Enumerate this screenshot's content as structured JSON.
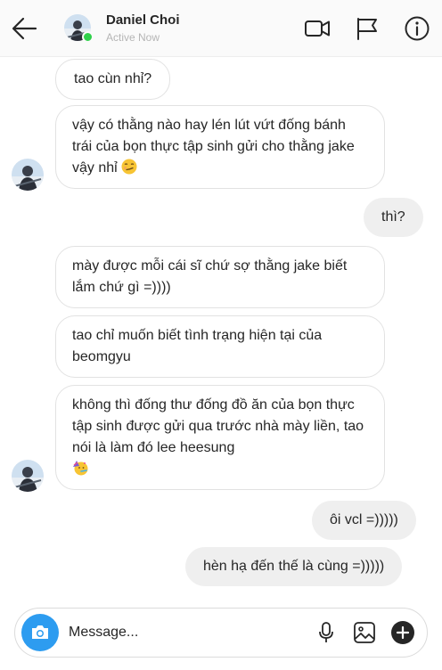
{
  "header": {
    "name": "Daniel Choi",
    "status": "Active Now"
  },
  "messages": [
    {
      "side": "in",
      "text": "tao cùn nhỉ?"
    },
    {
      "side": "in",
      "text": "vậy có thằng nào hay lén lút vứt đống bánh trái của bọn thực tập sinh gửi cho thằng jake vậy nhỉ",
      "emoji": "smirk-emoji"
    },
    {
      "side": "out",
      "text": "thì?"
    },
    {
      "side": "in",
      "text": "mày được mỗi cái sĩ chứ sợ thằng jake biết lắm chứ gì =))))"
    },
    {
      "side": "in",
      "text": "tao chỉ muốn biết tình trạng hiện tại của beomgyu"
    },
    {
      "side": "in",
      "text": "không thì đống thư đống đồ ăn của bọn thực tập sinh được gửi qua trước nhà mày liền, tao nói là làm đó lee heesung",
      "emoji": "party-face-emoji"
    },
    {
      "side": "out",
      "text": "ôi vcl =)))))"
    },
    {
      "side": "out",
      "text": "hèn hạ đến thế là cùng =)))))"
    }
  ],
  "composer": {
    "placeholder": "Message..."
  },
  "colors": {
    "online": "#2fd14b",
    "camera_button": "#2d9cf0",
    "outgoing_bubble": "#efefef"
  },
  "icons": [
    "back-arrow-icon",
    "video-call-icon",
    "flag-icon",
    "info-icon",
    "camera-icon",
    "microphone-icon",
    "image-icon",
    "plus-icon"
  ]
}
